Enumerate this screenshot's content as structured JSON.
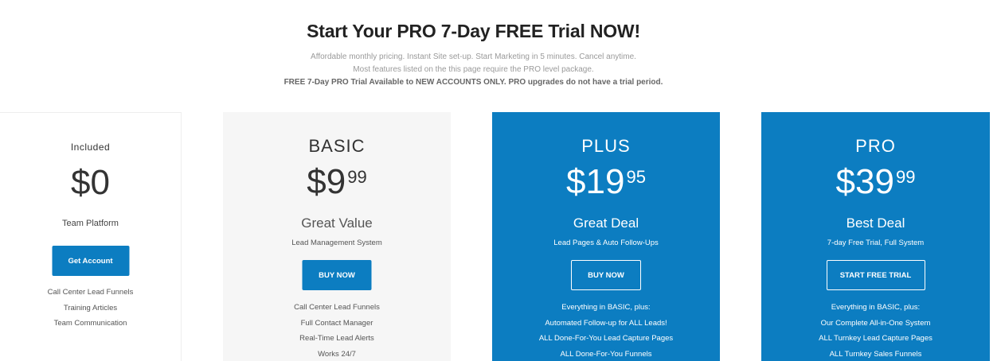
{
  "header": {
    "title": "Start Your PRO 7-Day FREE Trial NOW!",
    "line1": "Affordable monthly pricing. Instant Site set-up. Start Marketing in 5 minutes. Cancel anytime.",
    "line2": "Most features listed on the this page require the PRO level package.",
    "line3": "FREE 7-Day PRO Trial Available to NEW ACCOUNTS ONLY. PRO upgrades do not have a trial period."
  },
  "colors": {
    "accent": "#0c7dc1",
    "basic_bg": "#f6f6f6"
  },
  "plans": [
    {
      "name": "Included",
      "price": "$0",
      "cents": "",
      "subtitle": "Team Platform",
      "description": "",
      "button": "Get Account",
      "features": [
        "Call Center Lead Funnels",
        "Training Articles",
        "Team Communication"
      ]
    },
    {
      "name": "BASIC",
      "price": "$9",
      "cents": "99",
      "subtitle": "Great Value",
      "description": "Lead Management System",
      "button": "BUY NOW",
      "features": [
        "Call Center Lead Funnels",
        "Full Contact Manager",
        "Real-Time Lead Alerts",
        "Works 24/7"
      ]
    },
    {
      "name": "PLUS",
      "price": "$19",
      "cents": "95",
      "subtitle": "Great Deal",
      "description": "Lead Pages & Auto Follow-Ups",
      "button": "BUY NOW",
      "features": [
        "Everything in BASIC, plus:",
        "Automated Follow-up for ALL Leads!",
        "ALL Done-For-You Lead Capture Pages",
        "ALL Done-For-You Funnels"
      ]
    },
    {
      "name": "PRO",
      "price": "$39",
      "cents": "99",
      "subtitle": "Best Deal",
      "description": "7-day Free Trial, Full System",
      "button": "START FREE TRIAL",
      "features": [
        "Everything in BASIC, plus:",
        "Our Complete All-in-One System",
        "ALL Turnkey Lead Capture Pages",
        "ALL Turnkey Sales Funnels"
      ]
    }
  ]
}
